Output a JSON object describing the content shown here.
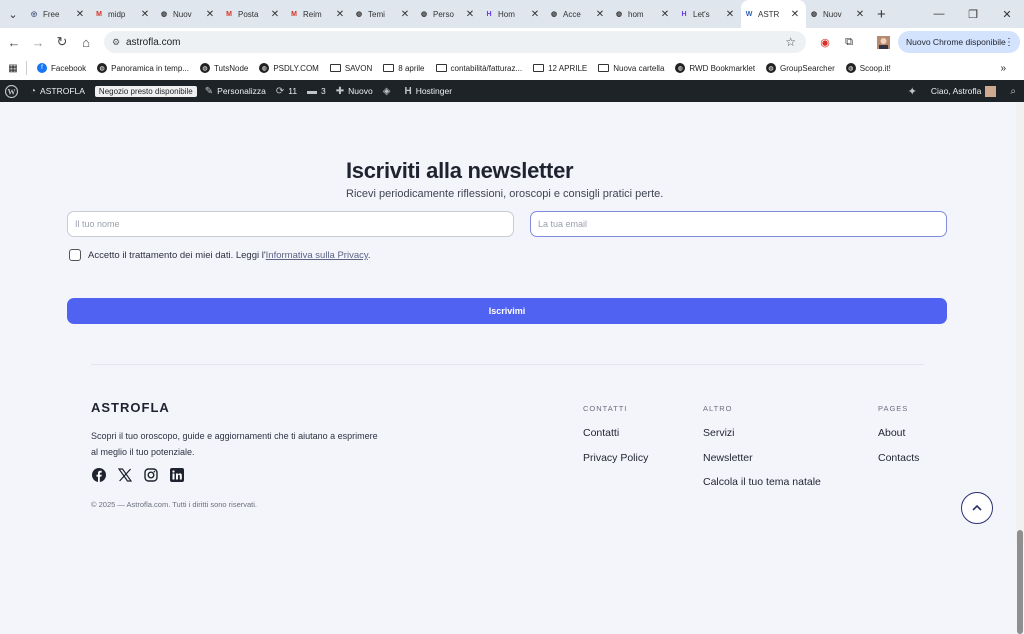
{
  "tabs": [
    {
      "title": "Free",
      "icon": "chatgpt-icon",
      "color": "#3d4f78"
    },
    {
      "title": "midp",
      "icon": "gmail-icon",
      "color": "#d93025"
    },
    {
      "title": "Nuov",
      "icon": "globe-icon",
      "color": "#333"
    },
    {
      "title": "Posta",
      "icon": "gmail-icon",
      "color": "#d93025"
    },
    {
      "title": "Reim",
      "icon": "gmail-icon",
      "color": "#d93025"
    },
    {
      "title": "Temi",
      "icon": "globe-icon",
      "color": "#333"
    },
    {
      "title": "Perso",
      "icon": "globe-icon",
      "color": "#333"
    },
    {
      "title": "Hom",
      "icon": "hostinger-icon",
      "color": "#673de6"
    },
    {
      "title": "Acce",
      "icon": "globe-icon",
      "color": "#333"
    },
    {
      "title": "hom",
      "icon": "globe-icon",
      "color": "#333"
    },
    {
      "title": "Let's",
      "icon": "hostinger-icon",
      "color": "#673de6"
    },
    {
      "title": "ASTR",
      "icon": "wordpress-icon",
      "color": "#2b5fb5",
      "active": true
    },
    {
      "title": "Nuov",
      "icon": "globe-icon",
      "color": "#333"
    }
  ],
  "address": {
    "url": "astrofla.com",
    "update_label": "Nuovo Chrome disponibile"
  },
  "bookmarks": [
    {
      "label": "Facebook",
      "icon": "facebook-icon"
    },
    {
      "label": "Panoramica in temp...",
      "icon": "globe-icon"
    },
    {
      "label": "TutsNode",
      "icon": "globe-icon"
    },
    {
      "label": "PSDLY.COM",
      "icon": "globe-icon"
    },
    {
      "label": "SAVON",
      "icon": "folder-icon"
    },
    {
      "label": "8 aprile",
      "icon": "folder-icon"
    },
    {
      "label": "contabilità/fatturaz...",
      "icon": "folder-icon"
    },
    {
      "label": "12 APRILE",
      "icon": "folder-icon"
    },
    {
      "label": "Nuova cartella",
      "icon": "folder-icon"
    },
    {
      "label": "RWD Bookmarklet",
      "icon": "globe-icon"
    },
    {
      "label": "GroupSearcher",
      "icon": "globe-icon"
    },
    {
      "label": "Scoop.it!",
      "icon": "globe-icon"
    }
  ],
  "wpbar": {
    "site": "ASTROFLA",
    "badge": "Negozio presto disponibile",
    "customize": "Personalizza",
    "updates": "11",
    "comments": "3",
    "new": "Nuovo",
    "hostinger": "Hostinger",
    "greeting": "Ciao, Astrofla"
  },
  "newsletter": {
    "title": "Iscriviti alla newsletter",
    "subtitle": "Ricevi periodicamente riflessioni, oroscopi e consigli pratici perte.",
    "name_placeholder": "Il tuo nome",
    "email_placeholder": "La tua email",
    "consent_text": "Accetto il trattamento dei miei dati. Leggi l'",
    "privacy_link": "Informativa sulla Privacy",
    "consent_end": ".",
    "submit": "Iscrivimi"
  },
  "footer": {
    "brand": "ASTROFLA",
    "description": "Scopri il tuo oroscopo, guide e aggiornamenti che ti aiutano a esprimere al meglio il tuo potenziale.",
    "copyright": "© 2025 — Astrofla.com. Tutti i diritti sono riservati.",
    "columns": [
      {
        "heading": "CONTATTI",
        "links": [
          "Contatti",
          "Privacy Policy"
        ]
      },
      {
        "heading": "ALTRO",
        "links": [
          "Servizi",
          "Newsletter",
          "Calcola il tuo tema natale"
        ]
      },
      {
        "heading": "PAGES",
        "links": [
          "About",
          "Contacts"
        ]
      }
    ]
  }
}
